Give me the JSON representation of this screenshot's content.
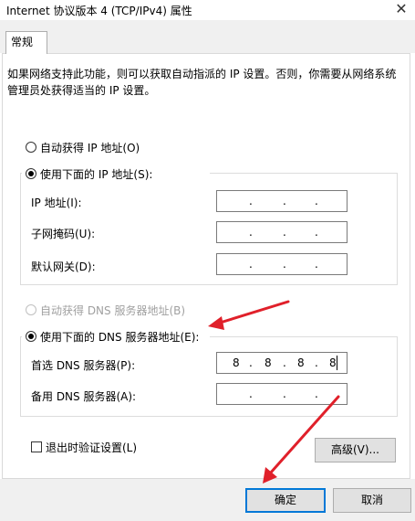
{
  "window": {
    "title": "Internet 协议版本 4 (TCP/IPv4) 属性",
    "close_glyph": "✕"
  },
  "tab": {
    "label": "常规"
  },
  "intro": "如果网络支持此功能，则可以获取自动指派的 IP 设置。否则，你需要从网络系统管理员处获得适当的 IP 设置。",
  "ip": {
    "auto_label": "自动获得 IP 地址(O)",
    "manual_label": "使用下面的 IP 地址(S):",
    "fields": [
      {
        "label": "IP 地址(I):",
        "octets": [
          "",
          "",
          "",
          ""
        ]
      },
      {
        "label": "子网掩码(U):",
        "octets": [
          "",
          "",
          "",
          ""
        ]
      },
      {
        "label": "默认网关(D):",
        "octets": [
          "",
          "",
          "",
          ""
        ]
      }
    ]
  },
  "dns": {
    "auto_label": "自动获得 DNS 服务器地址(B)",
    "manual_label": "使用下面的 DNS 服务器地址(E):",
    "fields": [
      {
        "label": "首选 DNS 服务器(P):",
        "octets": [
          "8",
          "8",
          "8",
          "8"
        ]
      },
      {
        "label": "备用 DNS 服务器(A):",
        "octets": [
          "",
          "",
          "",
          ""
        ]
      }
    ]
  },
  "validate_label": "退出时验证设置(L)",
  "advanced_label": "高级(V)...",
  "ok_label": "确定",
  "cancel_label": "取消",
  "dot": ".",
  "colors": {
    "annotation_arrow": "#e0202a",
    "focus": "#0078d7"
  }
}
